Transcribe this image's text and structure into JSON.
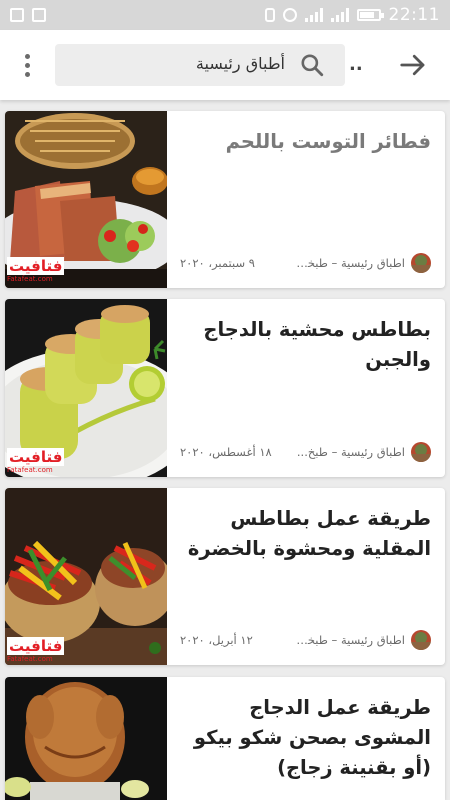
{
  "status_bar": {
    "time": "22:11"
  },
  "app_bar": {
    "search_text": "أطباق رئيسية",
    "overflow_label": "..",
    "icons": [
      "more-vert-icon",
      "search-icon",
      "arrow-forward-icon"
    ]
  },
  "articles": [
    {
      "title": "فطائر التوست باللحم",
      "categories": "اطباق رئيسية – طبخة ل...",
      "date": "٩ سبتمبر، ٢٠٢٠",
      "title_color": "#7a7a7a"
    },
    {
      "title": "بطاطس محشية بالدجاج والجبن",
      "categories": "اطباق رئيسية – طبخ...",
      "date": "١٨ أغسطس، ٢٠٢٠",
      "title_color": "#222222"
    },
    {
      "title": "طريقة عمل بطاطس المقلية ومحشوة بالخضرة",
      "categories": "اطباق رئيسية – طبخة لذ...",
      "date": "١٢ أبريل، ٢٠٢٠",
      "title_color": "#222222"
    },
    {
      "title": "طريقة عمل الدجاج المشوى بصحن شكو بيكو (أو بقنينة زجاج)",
      "categories": "",
      "date": "",
      "title_color": "#222222"
    }
  ],
  "watermark": {
    "brand": "فتافيت",
    "site": "Fatafeat.com"
  }
}
